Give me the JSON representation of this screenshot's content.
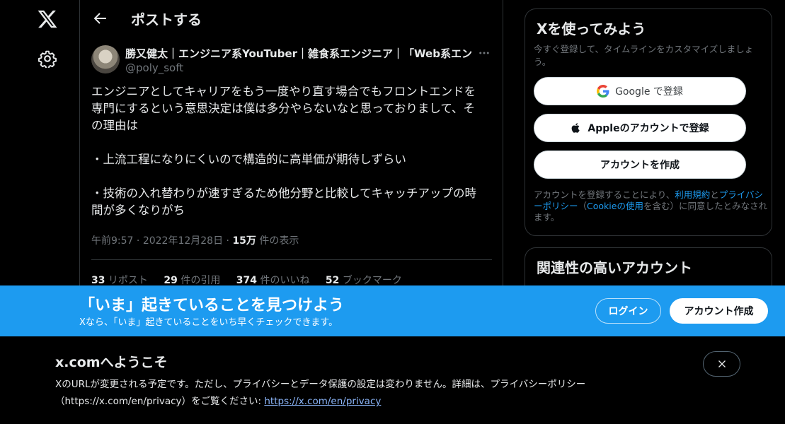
{
  "nav": {
    "logo_icon": "x-logo-icon",
    "settings_icon": "gear-icon"
  },
  "header": {
    "back_icon": "arrow-left-icon",
    "title": "ポストする"
  },
  "post": {
    "author_name": "勝又健太｜エンジニア系YouTuber｜雑食系エンジニア｜「Web系エンジ",
    "author_handle": "@poly_soft",
    "more_icon": "more-horizontal-icon",
    "text": {
      "line1": "エンジニアとしてキャリアをもう一度やり直す場合でもフロントエンドを",
      "line2": "専門にするという意思決定は僕は多分やらないなと思っておりまして、そ",
      "line3": "の理由は",
      "line4": "・上流工程になりにくいので構造的に高単価が期待しずらい",
      "line5": "・技術の入れ替わりが速すぎるため他分野と比較してキャッチアップの時",
      "line6": "間が多くなりがち"
    },
    "meta": {
      "time": "午前9:57",
      "sep1": " · ",
      "date": "2022年12月28日",
      "sep2": " · ",
      "views": "15万",
      "views_label": " 件の表示"
    },
    "stats": {
      "reposts": "33",
      "reposts_label": " リポスト",
      "quotes": "29",
      "quotes_label": " 件の引用",
      "likes": "374",
      "likes_label": " 件のいいね",
      "bookmarks": "52",
      "bookmarks_label": " ブックマーク"
    }
  },
  "signup": {
    "title": "Xを使ってみよう",
    "subtitle": "今すぐ登録して、タイムラインをカスタマイズしましょう。",
    "google_label": "Google で登録",
    "apple_label": "Appleのアカウントで登録",
    "create_label": "アカウントを作成",
    "legal_pre": "アカウントを登録することにより、",
    "legal_terms": "利用規約",
    "legal_and": "と",
    "legal_privacy": "プライバシーポリシー",
    "legal_paren_open": "（",
    "legal_cookie": "Cookieの使用",
    "legal_post": "を含む）に同意したとみなされます。"
  },
  "related": {
    "title": "関連性の高いアカウント"
  },
  "banner": {
    "title": "「いま」起きていることを見つけよう",
    "subtitle": "Xなら、「いま」起きていることをいち早くチェックできます。",
    "login_label": "ログイン",
    "create_label": "アカウント作成"
  },
  "welcome": {
    "title": "x.comへようこそ",
    "body": "XのURLが変更される予定です。ただし、プライバシーとデータ保護の設定は変わりません。詳細は、プライバシーポリシー（https://x.com/en/privacy）をご覧ください: ",
    "link": "https://x.com/en/privacy",
    "close_icon": "close-icon"
  },
  "colors": {
    "background": "#000000",
    "accent": "#1d9bf0",
    "muted": "#71767b",
    "border": "#2f3336"
  }
}
